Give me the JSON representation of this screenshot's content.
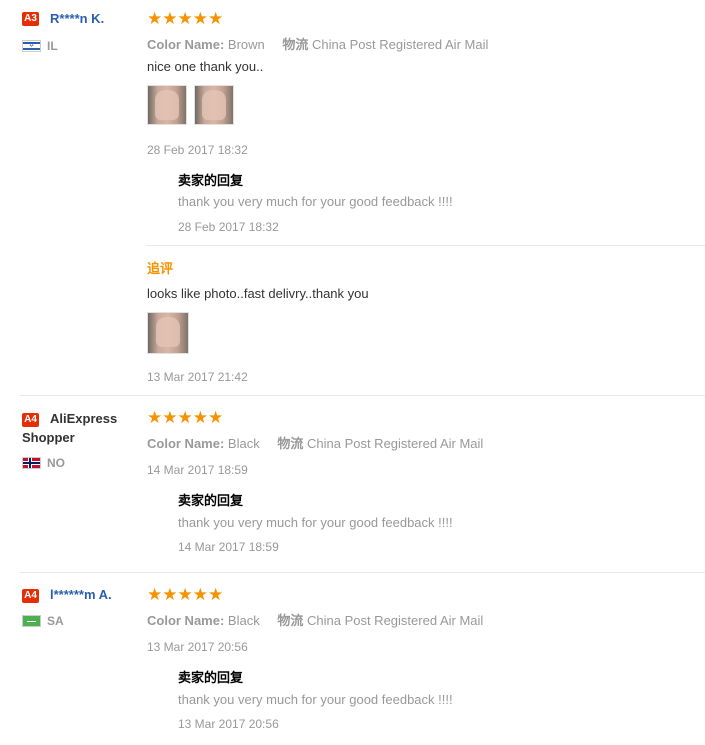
{
  "reviews": [
    {
      "badge": "A3",
      "name": "R****n K.",
      "country": "IL",
      "stars": "★★★★★",
      "color_label": "Color Name:",
      "color_value": "Brown",
      "ship_label": "物流",
      "ship_value": "China Post Registered Air Mail",
      "text": "nice one thank you..",
      "date": "28 Feb 2017 18:32",
      "reply_title": "卖家的回复",
      "reply_text": "thank you very much for your good feedback !!!!",
      "reply_date": "28 Feb 2017 18:32",
      "followup_label": "追评",
      "followup_text": "looks like photo..fast delivry..thank you",
      "followup_date": "13 Mar 2017 21:42"
    },
    {
      "badge": "A4",
      "name": "AliExpress Shopper",
      "country": "NO",
      "stars": "★★★★★",
      "color_label": "Color Name:",
      "color_value": "Black",
      "ship_label": "物流",
      "ship_value": "China Post Registered Air Mail",
      "date": "14 Mar 2017 18:59",
      "reply_title": "卖家的回复",
      "reply_text": "thank you very much for your good feedback !!!!",
      "reply_date": "14 Mar 2017 18:59"
    },
    {
      "badge": "A4",
      "name": "l******m A.",
      "country": "SA",
      "stars": "★★★★★",
      "color_label": "Color Name:",
      "color_value": "Black",
      "ship_label": "物流",
      "ship_value": "China Post Registered Air Mail",
      "date": "13 Mar 2017 20:56",
      "reply_title": "卖家的回复",
      "reply_text": "thank you very much for your good feedback !!!!",
      "reply_date": "13 Mar 2017 20:56"
    }
  ],
  "colors": {
    "accent": "#f59300",
    "badge": "#e62e04",
    "link": "#2a5fb0",
    "muted": "#999999"
  }
}
